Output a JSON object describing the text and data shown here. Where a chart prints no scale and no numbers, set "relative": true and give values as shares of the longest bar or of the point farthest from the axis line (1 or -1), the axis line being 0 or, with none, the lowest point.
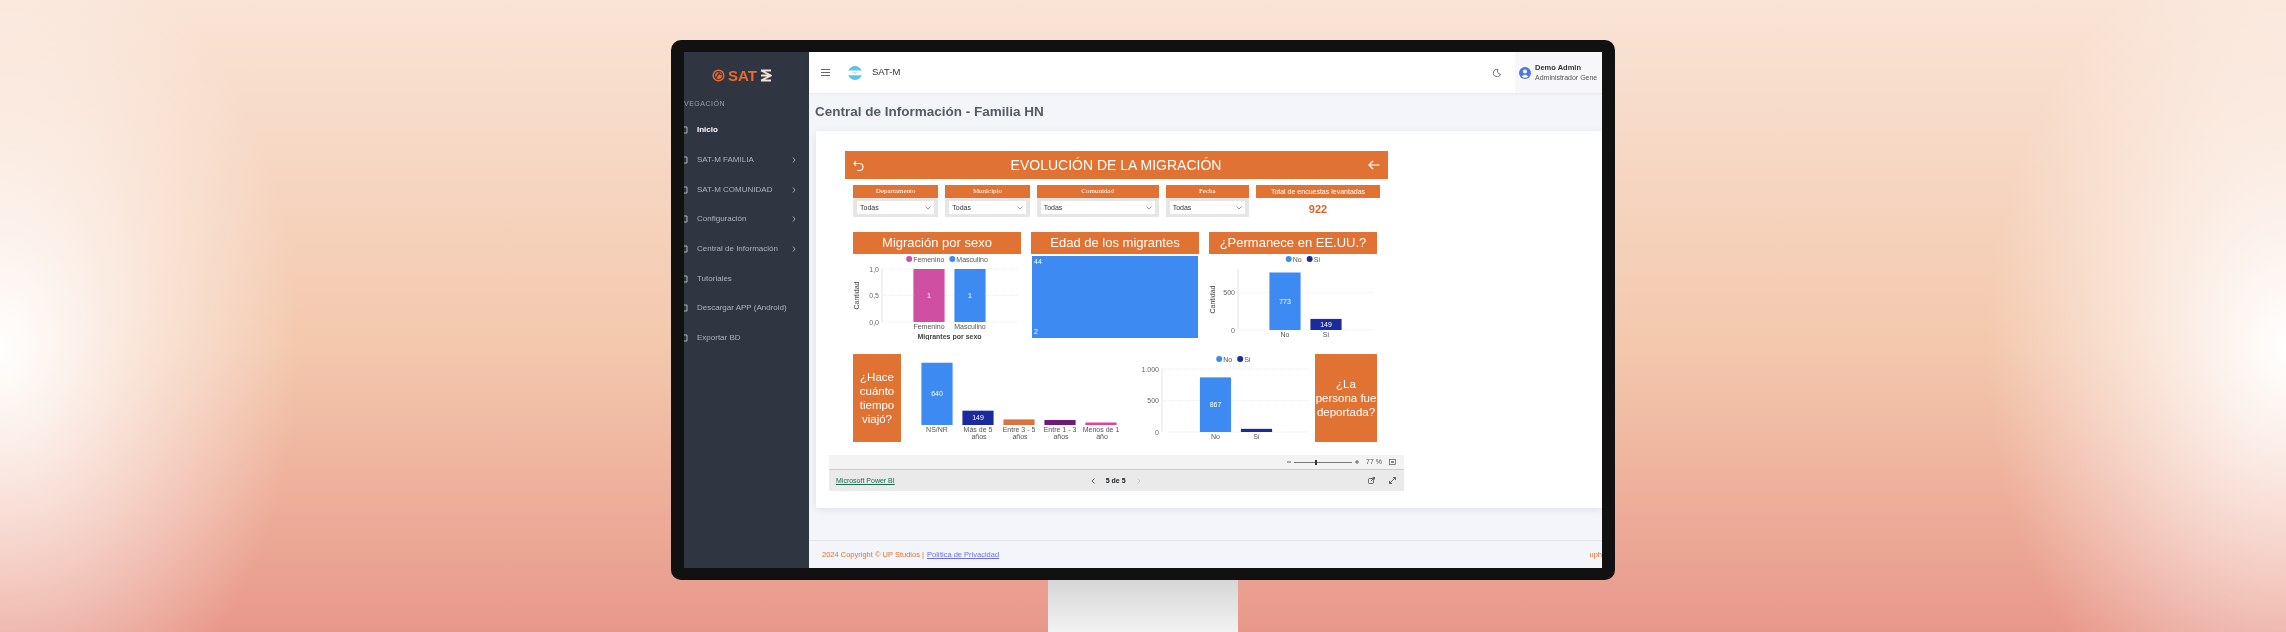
{
  "sidebar": {
    "logo": "SAT",
    "section": "VEGACIÓN",
    "items": [
      {
        "label": "Inicio",
        "selected": true,
        "expandable": false
      },
      {
        "label": "SAT-M FAMILIA",
        "selected": false,
        "expandable": true
      },
      {
        "label": "SAT-M COMUNIDAD",
        "selected": false,
        "expandable": true
      },
      {
        "label": "Configuración",
        "selected": false,
        "expandable": true
      },
      {
        "label": "Central de Información",
        "selected": false,
        "expandable": true
      },
      {
        "label": "Tutoriales",
        "selected": false,
        "expandable": false
      },
      {
        "label": "Descargar APP (Android)",
        "selected": false,
        "expandable": false
      },
      {
        "label": "Exportar BD",
        "selected": false,
        "expandable": false
      }
    ]
  },
  "topbar": {
    "brand": "SAT-M",
    "user_name": "Demo Admin",
    "user_role": "Administrador Gene"
  },
  "page_title": "Central de Información - Familia HN",
  "report": {
    "title": "EVOLUCIÓN DE LA MIGRACIÓN",
    "filters": [
      {
        "label": "Departamento",
        "value": "Todas"
      },
      {
        "label": "Municipio",
        "value": "Todas"
      },
      {
        "label": "Comunidad",
        "value": "Todas"
      },
      {
        "label": "Fecha",
        "value": "Todas"
      }
    ],
    "total": {
      "label": "Total de encuestas levantadas",
      "value": "922"
    },
    "panels": [
      {
        "kind": "chart",
        "title": "Migración por sexo",
        "chart_data": {
          "type": "bar",
          "legend": "top",
          "xlabel": "Migrantes por sexo",
          "ylabel": "Cantidad",
          "categories": [
            "Femenino",
            "Masculino"
          ],
          "stacked": true,
          "ylim": [
            0,
            1
          ],
          "yticks": [
            {
              "value": 0,
              "label": "0,0"
            },
            {
              "value": 0.5,
              "label": "0,5"
            },
            {
              "value": 1,
              "label": "1,0"
            }
          ],
          "value_labels": [
            "1",
            "1"
          ],
          "series": [
            {
              "name": "Femenino",
              "color": "#cf4fa3",
              "values": [
                1,
                null
              ]
            },
            {
              "name": "Masculino",
              "color": "#3d8bf2",
              "values": [
                null,
                1
              ]
            }
          ]
        }
      },
      {
        "kind": "treemap",
        "title": "Edad de los migrantes",
        "labels": [
          "44",
          "2"
        ]
      },
      {
        "kind": "chart",
        "title": "¿Permanece en EE.UU.?",
        "chart_data": {
          "type": "bar",
          "legend": "top",
          "ylabel": "Cantidad",
          "categories": [
            "No",
            "Sí"
          ],
          "stacked": true,
          "ylim": [
            0,
            820
          ],
          "yticks": [
            0,
            500
          ],
          "value_labels": [
            "773",
            "149"
          ],
          "series": [
            {
              "name": "No",
              "color": "#3d8bf2",
              "values": [
                773,
                null
              ]
            },
            {
              "name": "Sí",
              "color": "#1b2a9c",
              "values": [
                null,
                149
              ]
            }
          ]
        }
      }
    ],
    "bottom_panels": [
      {
        "kind": "label",
        "title": "¿Hace cuánto tiempo viajó?"
      },
      {
        "kind": "chart",
        "chart_data": {
          "type": "bar",
          "relative": true,
          "categories": [
            "NS/NR",
            "Más de 5 años",
            "Entre 3 - 5 años",
            "Entre 1 - 3 años",
            "Menos de 1 año"
          ],
          "value_labels": [
            "640",
            "149",
            null,
            null,
            null
          ],
          "series": [
            {
              "colors": [
                "#3d8bf2",
                "#1b2a9c",
                "#d9733f",
                "#6a1b7a",
                "#e0409e"
              ],
              "values": [
                1,
                0.23,
                0.09,
                0.08,
                0.04
              ]
            }
          ]
        }
      },
      {
        "kind": "chart",
        "chart_data": {
          "type": "bar",
          "legend": "top",
          "categories": [
            "No",
            "Sí"
          ],
          "stacked": true,
          "ylim": [
            0,
            1000
          ],
          "yticks": [
            0,
            500,
            {
              "value": 1000,
              "label": "1.000"
            }
          ],
          "value_labels": [
            "867",
            null
          ],
          "series": [
            {
              "name": "No",
              "color": "#3d8bf2",
              "values": [
                867,
                null
              ]
            },
            {
              "name": "Sí",
              "color": "#1b2a9c",
              "values": [
                null,
                50
              ]
            }
          ]
        }
      },
      {
        "kind": "label",
        "title": "¿La persona fue deportada?"
      }
    ]
  },
  "viewer": {
    "zoom_slider": {
      "level": 0.38
    },
    "zoom": "77 %",
    "brand_link": "Microsoft Power BI",
    "page": "5 de 5",
    "prev_disabled": false,
    "next_disabled": true
  },
  "footer": {
    "copyright": "2024 Copyright © UP Studios |",
    "privacy": "Política de Privacidad",
    "right": "uph"
  }
}
